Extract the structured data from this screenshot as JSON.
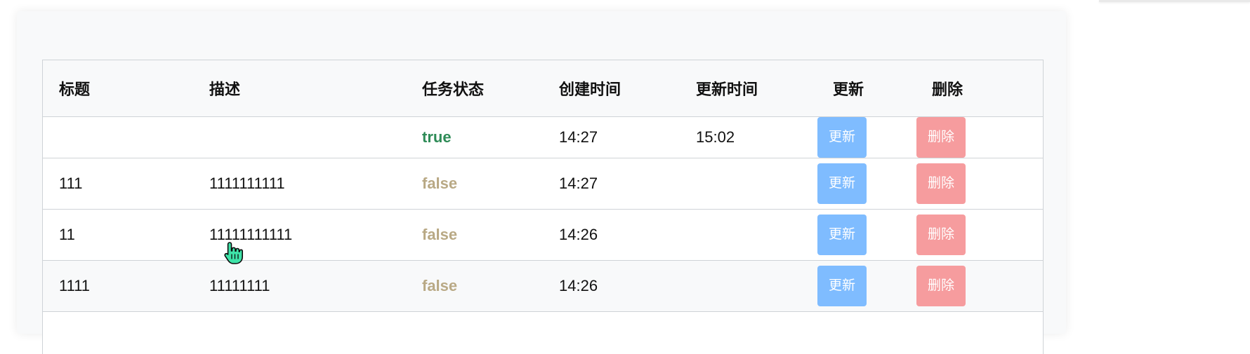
{
  "table": {
    "headers": [
      "标题",
      "描述",
      "任务状态",
      "创建时间",
      "更新时间",
      "更新",
      "删除"
    ],
    "rows": [
      {
        "title": "",
        "description": "",
        "status": "true",
        "created": "14:27",
        "updated": "15:02",
        "update_label": "更新",
        "delete_label": "删除"
      },
      {
        "title": "111",
        "description": "1111111111",
        "status": "false",
        "created": "14:27",
        "updated": "",
        "update_label": "更新",
        "delete_label": "删除"
      },
      {
        "title": "11",
        "description": "11111111111",
        "status": "false",
        "created": "14:26",
        "updated": "",
        "update_label": "更新",
        "delete_label": "删除"
      },
      {
        "title": "1111",
        "description": "11111111",
        "status": "false",
        "created": "14:26",
        "updated": "",
        "update_label": "更新",
        "delete_label": "删除"
      }
    ]
  },
  "colors": {
    "status_true": "#2e8b57",
    "status_false": "#b9a985",
    "update_button": "#7fbcff",
    "delete_button": "#f69c9e"
  },
  "icons": {
    "cursor": "hand-pointer-icon"
  }
}
